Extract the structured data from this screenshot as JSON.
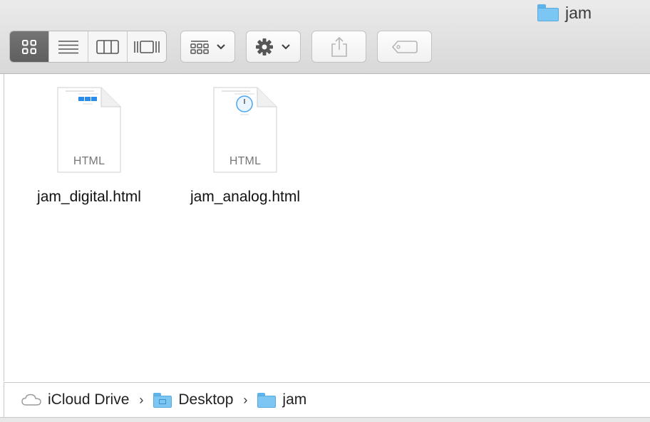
{
  "window": {
    "title": "jam"
  },
  "toolbar": {
    "view_modes": [
      {
        "name": "icon-view",
        "active": true
      },
      {
        "name": "list-view",
        "active": false
      },
      {
        "name": "column-view",
        "active": false
      },
      {
        "name": "cover-flow-view",
        "active": false
      }
    ],
    "icons": [
      "arrange-icon",
      "gear-icon",
      "share-icon",
      "tag-icon"
    ]
  },
  "files": [
    {
      "name": "jam_digital.html",
      "type": "HTML"
    },
    {
      "name": "jam_analog.html",
      "type": "HTML"
    }
  ],
  "path": [
    {
      "label": "iCloud Drive",
      "icon": "cloud-icon"
    },
    {
      "label": "Desktop",
      "icon": "desktop-folder-icon"
    },
    {
      "label": "jam",
      "icon": "folder-icon"
    }
  ],
  "colors": {
    "folder": "#7cc6f3",
    "toolbar": "#dcdcdc",
    "active_segment": "#6a6a6a"
  }
}
